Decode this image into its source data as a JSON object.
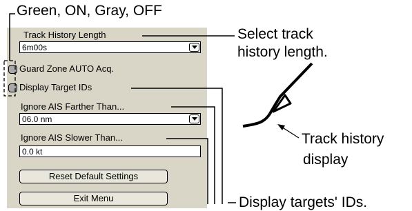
{
  "annotations": {
    "checkbox_legend": "Green, ON, Gray, OFF",
    "track_select_line1": "Select track",
    "track_select_line2": "history length.",
    "track_display_line1": "Track history",
    "track_display_line2": "display",
    "target_ids": "Display targets' IDs."
  },
  "menu": {
    "track_history_label": "Track History Length",
    "track_history_value": "6m00s",
    "guard_zone_label": "Guard Zone AUTO Acq.",
    "display_ids_label": "Display Target IDs",
    "ignore_far_label": "Ignore AIS Farther Than...",
    "ignore_far_value": "06.0 nm",
    "ignore_slow_label": "Ignore AIS Slower Than...",
    "ignore_slow_value": "0.0 kt",
    "reset_label": "Reset Default Settings",
    "exit_label": "Exit Menu"
  },
  "colors": {
    "panel_bg": "#d9d6c7",
    "checkbox_off": "#a9a9a9"
  }
}
